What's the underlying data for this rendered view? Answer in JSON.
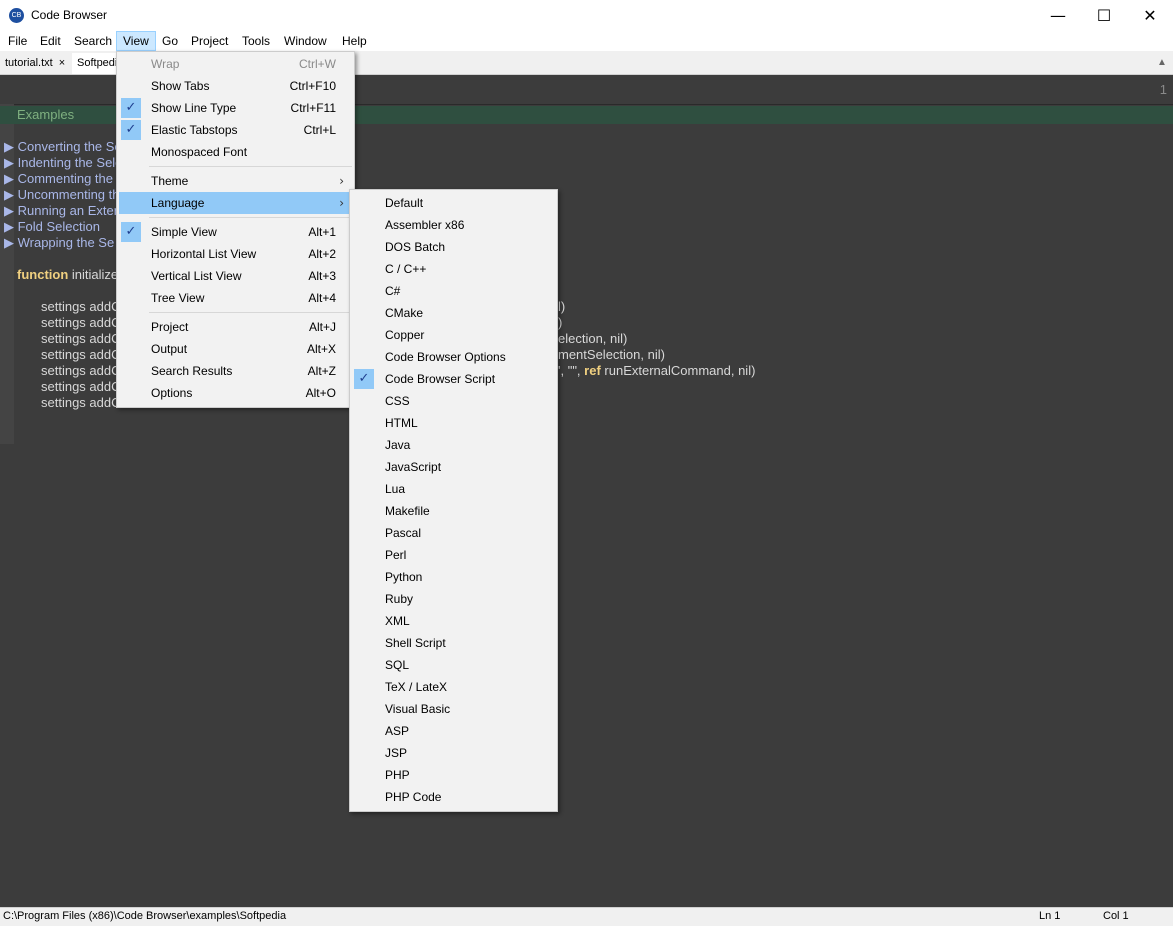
{
  "window": {
    "title": "Code Browser",
    "minimize": "—",
    "maximize": "☐",
    "close": "✕"
  },
  "menubar": [
    "File",
    "Edit",
    "Search",
    "View",
    "Go",
    "Project",
    "Tools",
    "Window",
    "Help"
  ],
  "tabs": [
    {
      "label": "tutorial.txt",
      "close": "×"
    },
    {
      "label": "Softpedi"
    }
  ],
  "editor": {
    "line_number": "1",
    "examples": "Examples",
    "folds": [
      "Converting the Se",
      "Indenting the Sele",
      "Commenting the",
      "Uncommenting th",
      "Running an Exter",
      "Fold Selection",
      "Wrapping the Se"
    ],
    "function_kw": "function",
    "function_rest": " initialize",
    "settings_prefix": "settings addC",
    "settings_last": "settings addC",
    "tails": [
      "l)",
      ")",
      "election, nil)",
      "mentSelection, nil)"
    ],
    "tail5_a": "', \"\", ",
    "tail5_kw": "ref",
    "tail5_b": " runExternalCommand, nil)"
  },
  "view_menu": [
    {
      "label": "Wrap",
      "shortcut": "Ctrl+W",
      "checked": false,
      "disabled": true
    },
    {
      "label": "Show Tabs",
      "shortcut": "Ctrl+F10",
      "checked": false
    },
    {
      "label": "Show Line Type",
      "shortcut": "Ctrl+F11",
      "checked": true
    },
    {
      "label": "Elastic Tabstops",
      "shortcut": "Ctrl+L",
      "checked": true
    },
    {
      "label": "Monospaced Font",
      "shortcut": "",
      "checked": false
    },
    {
      "label": "Theme",
      "submenu": true
    },
    {
      "label": "Language",
      "submenu": true,
      "highlighted": true
    },
    {
      "label": "Simple View",
      "shortcut": "Alt+1",
      "checked": true
    },
    {
      "label": "Horizontal List View",
      "shortcut": "Alt+2"
    },
    {
      "label": "Vertical List View",
      "shortcut": "Alt+3"
    },
    {
      "label": "Tree View",
      "shortcut": "Alt+4"
    },
    {
      "label": "Project",
      "shortcut": "Alt+J"
    },
    {
      "label": "Output",
      "shortcut": "Alt+X"
    },
    {
      "label": "Search Results",
      "shortcut": "Alt+Z"
    },
    {
      "label": "Options",
      "shortcut": "Alt+O"
    }
  ],
  "check_glyph": "✓",
  "arrow_glyph": "›",
  "language_menu": [
    "Default",
    "Assembler x86",
    "DOS Batch",
    "C / C++",
    "C#",
    "CMake",
    "Copper",
    "Code Browser Options",
    "Code Browser Script",
    "CSS",
    "HTML",
    "Java",
    "JavaScript",
    "Lua",
    "Makefile",
    "Pascal",
    "Perl",
    "Python",
    "Ruby",
    "XML",
    "Shell Script",
    "SQL",
    "TeX / LateX",
    "Visual Basic",
    "ASP",
    "JSP",
    "PHP",
    "PHP Code"
  ],
  "language_checked_index": 8,
  "status": {
    "path": "C:\\Program Files (x86)\\Code Browser\\examples\\Softpedia",
    "ln": "Ln 1",
    "col": "Col 1"
  }
}
